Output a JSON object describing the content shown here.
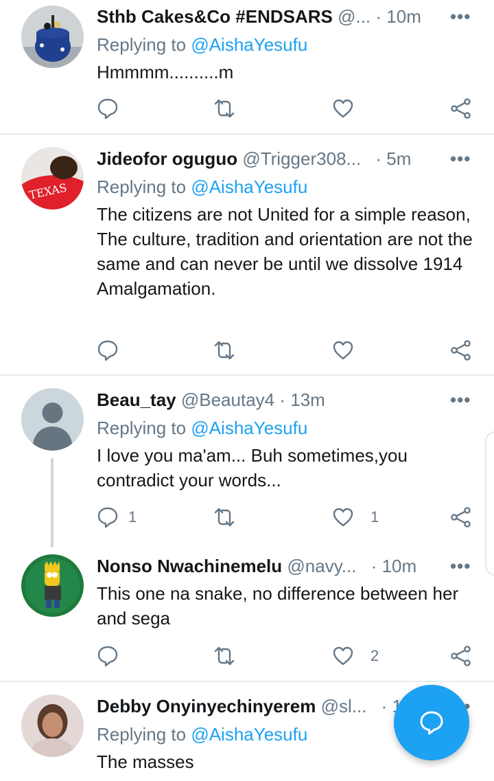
{
  "tweets": [
    {
      "name": "Sthb Cakes&Co #ENDSARS",
      "handle": "@...",
      "time": "· 10m",
      "replying_prefix": "Replying to ",
      "replying_to": "@AishaYesufu",
      "text": "Hmmmm..........m",
      "reply_count": "",
      "retweet_count": "",
      "like_count": ""
    },
    {
      "name": "Jideofor oguguo",
      "handle": "@Trigger308...",
      "time": "· 5m",
      "replying_prefix": "Replying to ",
      "replying_to": "@AishaYesufu",
      "text": "The citizens are not United for a simple reason,\nThe culture, tradition and orientation are not the same and can never be until we dissolve 1914 Amalgamation.",
      "reply_count": "",
      "retweet_count": "",
      "like_count": ""
    },
    {
      "name": "Beau_tay",
      "handle": "@Beautay4",
      "time": "· 13m",
      "replying_prefix": "Replying to ",
      "replying_to": "@AishaYesufu",
      "text": "I love you ma'am... Buh sometimes,you contradict your words...",
      "reply_count": "1",
      "retweet_count": "",
      "like_count": "1"
    },
    {
      "name": "Nonso Nwachinemelu",
      "handle": "@navy...",
      "time": "· 10m",
      "text": "This one na snake, no difference between her and sega",
      "reply_count": "",
      "retweet_count": "",
      "like_count": "2"
    },
    {
      "name": "Debby Onyinyechinyerem",
      "handle": "@sl...",
      "time": "· 1",
      "replying_prefix": "Replying to ",
      "replying_to": "@AishaYesufu",
      "text": "The masses"
    }
  ],
  "more_glyph": "•••",
  "icons": {
    "reply": "reply-icon",
    "retweet": "retweet-icon",
    "like": "heart-icon",
    "share": "share-icon",
    "compose": "compose-reply-icon"
  },
  "colors": {
    "accent": "#1da1f2",
    "secondary_text": "#657786",
    "primary_text": "#14171a",
    "divider": "#e6ecf0"
  }
}
